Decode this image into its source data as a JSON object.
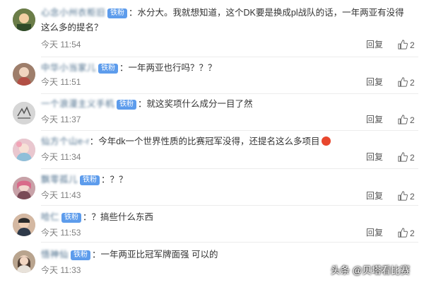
{
  "comments": [
    {
      "username": "心念小州衣柜旧",
      "badge": "铁粉",
      "text": "水分大。我就想知道，这个DK要是换成pl战队的话，一年两亚有没得这么多的提名？",
      "time": "今天 11:54",
      "reply_label": "回复",
      "likes": "2"
    },
    {
      "username": "中华小当家儿",
      "badge": "铁粉",
      "text": "一年两亚也行吗？？？",
      "time": "今天 11:51",
      "reply_label": "回复",
      "likes": "2"
    },
    {
      "username": "一个浪漫主义手机",
      "badge": "铁粉",
      "text": "就这奖项什么成分一目了然",
      "time": "今天 11:37",
      "reply_label": "回复",
      "likes": "2"
    },
    {
      "username": "仙方个山e-r",
      "badge": "",
      "text": "今年dk一个世界性质的比赛冠军没得，还提名这么多项目",
      "time": "今天 11:34",
      "reply_label": "回复",
      "likes": "2"
    },
    {
      "username": "飘零孤儿",
      "badge": "铁粉",
      "text": "？？",
      "time": "今天 11:43",
      "reply_label": "回复",
      "likes": "2"
    },
    {
      "username": "哈仁",
      "badge": "铁粉",
      "text": "？搞些什么东西",
      "time": "今天 11:53",
      "reply_label": "回复",
      "likes": "2"
    },
    {
      "username": "悟神仙",
      "badge": "铁粉",
      "text": "一年两亚比冠军牌面强  可以的",
      "time": "今天 11:33",
      "reply_label": "回复",
      "likes": "2"
    }
  ],
  "watermark": "头条 @贝塔看比赛",
  "colors": {
    "username": "#4b6e8c",
    "badge_bg": "#5d9cec",
    "meta": "#808080"
  }
}
